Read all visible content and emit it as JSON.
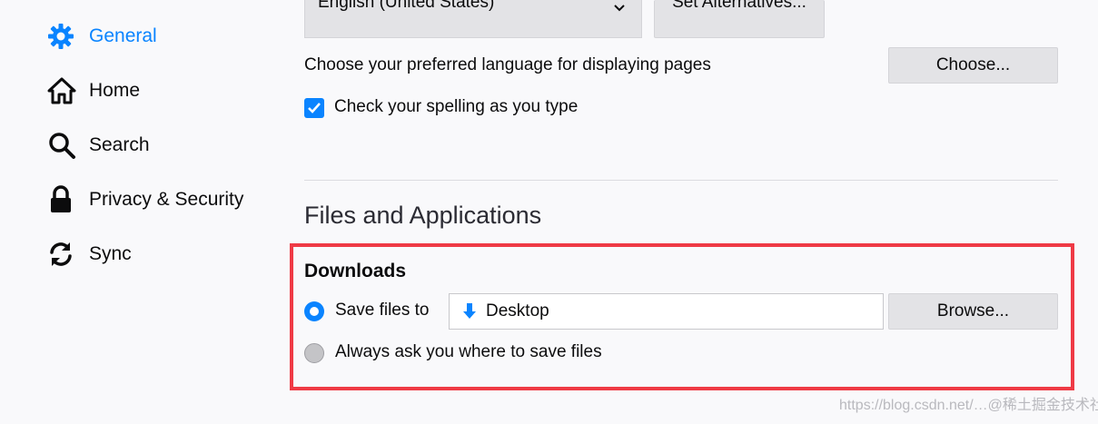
{
  "sidebar": {
    "items": [
      {
        "label": "General",
        "icon": "gear-icon",
        "active": true
      },
      {
        "label": "Home",
        "icon": "home-icon",
        "active": false
      },
      {
        "label": "Search",
        "icon": "search-icon",
        "active": false
      },
      {
        "label": "Privacy & Security",
        "icon": "lock-icon",
        "active": false
      },
      {
        "label": "Sync",
        "icon": "sync-icon",
        "active": false
      }
    ]
  },
  "language": {
    "selected": "English (United States)",
    "alternatives_button": "Set Alternatives...",
    "pages_label": "Choose your preferred language for displaying pages",
    "choose_button": "Choose...",
    "spell_check_label": "Check your spelling as you type",
    "spell_check_checked": true
  },
  "files": {
    "heading": "Files and Applications",
    "downloads_heading": "Downloads",
    "save_files_label": "Save files to",
    "save_files_selected": true,
    "folder": "Desktop",
    "browse_button": "Browse...",
    "always_ask_label": "Always ask you where to save files",
    "always_ask_selected": false
  },
  "watermark": "https://blog.csdn.net/…@稀土掘金技术社区",
  "colors": {
    "accent": "#0a84ff",
    "highlight": "#ef3a45"
  }
}
